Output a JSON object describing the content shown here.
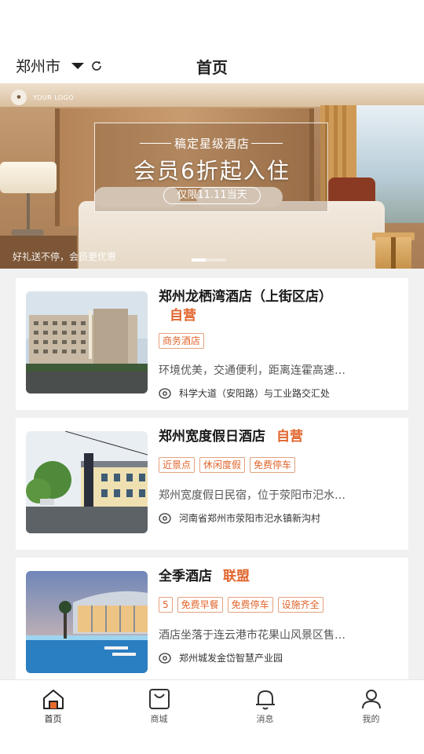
{
  "header": {
    "city": "郑州市",
    "title": "首页"
  },
  "banner": {
    "logo_text": "YOUR LOGO",
    "promo_subtitle": "稿定星级酒店",
    "promo_main": "会员6折起入住",
    "promo_pill": "仅限11.11当天",
    "slogan": "好礼送不停，会员更优惠",
    "dots": 2,
    "active_dot": 0
  },
  "hotels": [
    {
      "name": "郑州龙栖湾酒店（上街区店）",
      "badge": "自营",
      "tags": [
        "商务酒店"
      ],
      "desc": "环境优美，交通便利，距离连霍高速…",
      "address": "科学大道（安阳路）与工业路交汇处"
    },
    {
      "name": "郑州宽度假日酒店",
      "badge": "自营",
      "tags": [
        "近景点",
        "休闲度假",
        "免费停车"
      ],
      "desc": "郑州宽度假日民宿，位于荥阳市汜水…",
      "address": "河南省郑州市荥阳市汜水镇新沟村"
    },
    {
      "name": "全季酒店",
      "badge": "联盟",
      "tags": [
        "5",
        "免费早餐",
        "免费停车",
        "设施齐全"
      ],
      "desc": "酒店坐落于连云港市花果山风景区售…",
      "address": "郑州城发金岱智慧产业园"
    }
  ],
  "tabbar": {
    "items": [
      {
        "label": "首页",
        "icon": "home-icon",
        "active": true
      },
      {
        "label": "商城",
        "icon": "shopping-bag-icon",
        "active": false
      },
      {
        "label": "消息",
        "icon": "bell-icon",
        "active": false
      },
      {
        "label": "我的",
        "icon": "user-icon",
        "active": false
      }
    ]
  },
  "colors": {
    "accent": "#e0652c",
    "background": "#f1f1f1"
  }
}
